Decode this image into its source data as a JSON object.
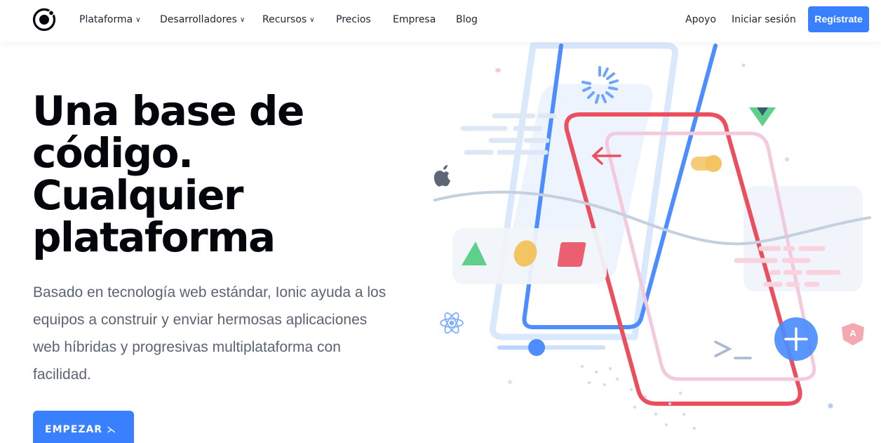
{
  "nav": {
    "links": [
      {
        "label": "Plataforma",
        "dropdown": true
      },
      {
        "label": "Desarrolladores",
        "dropdown": true
      },
      {
        "label": "Recursos",
        "dropdown": true
      },
      {
        "label": "Precios",
        "dropdown": false
      },
      {
        "label": "Empresa",
        "dropdown": false
      },
      {
        "label": "Blog",
        "dropdown": false
      }
    ],
    "support": "Apoyo",
    "login": "Iniciar sesión",
    "signup": "Regístrate"
  },
  "hero": {
    "title_lines": [
      "Una base de",
      "código.",
      "Cualquier",
      "plataforma"
    ],
    "description": "Basado en tecnología web estándar, Ionic ayuda a los equipos a construir y enviar hermosas aplicaciones web híbridas y progresivas multiplataforma con facilidad.",
    "cta_label": "EMPEZAR",
    "cta_icon": "terminal-prompt-icon"
  },
  "colors": {
    "accent": "#3880ff",
    "heading": "#03060b",
    "body_text": "#5b6472",
    "illus_red": "#eb4f5d",
    "illus_blue": "#4c8dff",
    "illus_green": "#5fd08b",
    "illus_yellow": "#f2c462"
  },
  "illustration": {
    "icons": [
      "ionic-logo-icon",
      "apple-icon",
      "react-icon",
      "vue-icon",
      "angular-icon",
      "plus-icon",
      "arrow-left-icon",
      "loading-spinner-icon",
      "terminal-prompt-icon"
    ]
  }
}
